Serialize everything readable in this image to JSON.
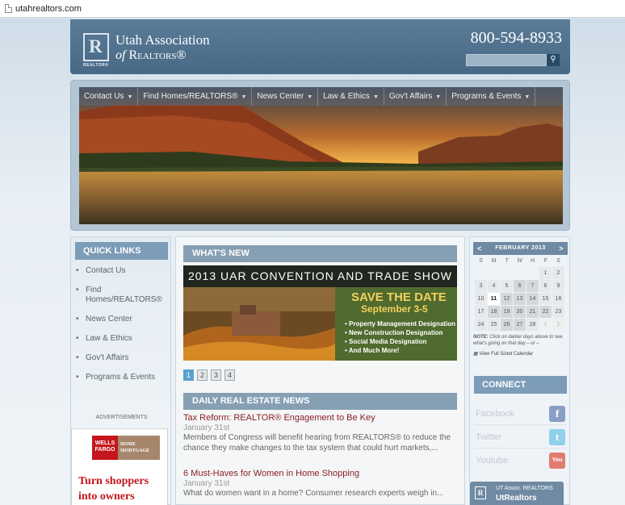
{
  "browser": {
    "url": "utahrealtors.com"
  },
  "header": {
    "logo_letter": "R",
    "logo_sub": "REALTOR®",
    "org_line1": "Utah Association",
    "org_line2_of": "of",
    "org_line2": "Realtors®",
    "phone": "800-594-8933",
    "search_icon": "search-icon"
  },
  "nav": {
    "items": [
      {
        "label": "Contact Us"
      },
      {
        "label": "Find Homes/REALTORS®"
      },
      {
        "label": "News Center"
      },
      {
        "label": "Law & Ethics"
      },
      {
        "label": "Gov't Affairs"
      },
      {
        "label": "Programs & Events"
      }
    ]
  },
  "quick_links": {
    "title": "QUICK LINKS",
    "items": [
      {
        "label": "Contact Us"
      },
      {
        "label": "Find Homes/REALTORS®"
      },
      {
        "label": "News Center"
      },
      {
        "label": "Law & Ethics"
      },
      {
        "label": "Gov't Affairs"
      },
      {
        "label": "Programs & Events"
      }
    ],
    "ads_label": "ADVERTISEMENTS",
    "ad": {
      "wf": "WELLS FARGO",
      "hm": "HOME MORTGAGE",
      "line1": "Turn shoppers",
      "line2": "into owners"
    }
  },
  "whats_new": {
    "title": "WHAT'S NEW",
    "banner": {
      "headline": "2013 UAR CONVENTION AND TRADE SHOW",
      "save_the_date": "SAVE THE DATE",
      "dates": "September 3-5",
      "items": [
        "Property Management Designation",
        "New Construction Designation",
        "Social Media Designation",
        "And Much More!"
      ]
    },
    "pages": [
      "1",
      "2",
      "3",
      "4"
    ],
    "active_page": "1"
  },
  "daily_news": {
    "title": "DAILY REAL ESTATE NEWS",
    "articles": [
      {
        "title": "Tax Reform: REALTOR® Engagement to Be Key",
        "date": "January 31st",
        "body": "Members of Congress will benefit hearing from REALTORS® to reduce the chance they make changes to the tax system that could hurt markets,..."
      },
      {
        "title": "6 Must-Haves for Women in Home Shopping",
        "date": "January 31st",
        "body": "What do women want in a home? Consumer research experts weigh in..."
      }
    ]
  },
  "calendar": {
    "month": "FEBRUARY 2013",
    "prev": "<",
    "next": ">",
    "dow": [
      "S",
      "M",
      "T",
      "W",
      "H",
      "F",
      "S"
    ],
    "note_bold": "NOTE:",
    "note": "Click on darker days above to see what's going on that day – or –",
    "link": "View Full Sized Calendar"
  },
  "connect": {
    "title": "CONNECT",
    "items": [
      {
        "label": "Facebook",
        "icon": "facebook-icon",
        "glyph": "f",
        "color": "#8a9fc6"
      },
      {
        "label": "Twitter",
        "icon": "twitter-icon",
        "glyph": "t",
        "color": "#8fd0ea"
      },
      {
        "label": "Youtube",
        "icon": "youtube-icon",
        "glyph": "You",
        "color": "#e27b6f"
      }
    ]
  },
  "ut_badge": {
    "logo_letter": "R",
    "line1": "UT Assoc. REALTORS",
    "line2": "UtRealtors"
  }
}
